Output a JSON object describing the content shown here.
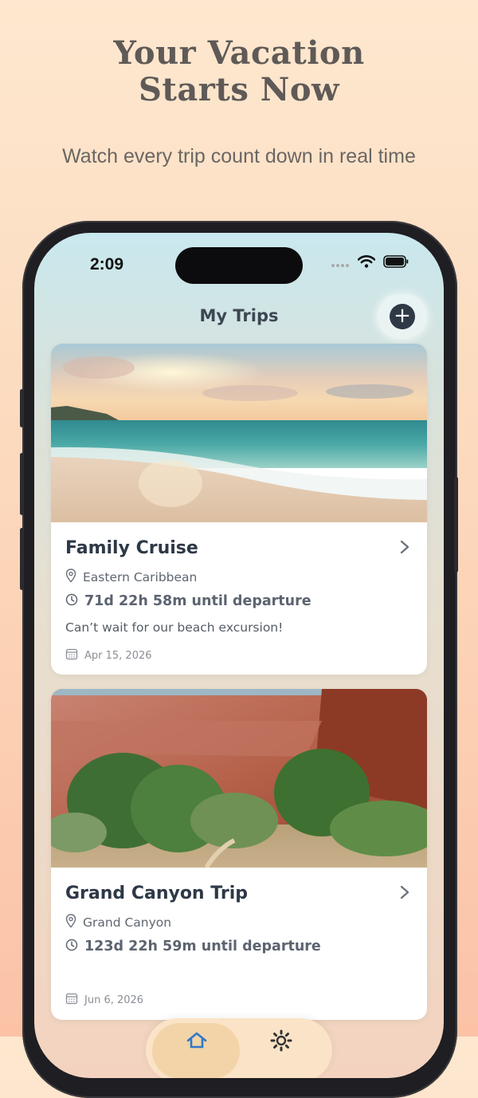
{
  "promo": {
    "headline_line1": "Your Vacation",
    "headline_line2": "Starts Now",
    "subtitle": "Watch every trip count down in real time"
  },
  "status_bar": {
    "time": "2:09"
  },
  "header": {
    "title": "My Trips"
  },
  "trips": [
    {
      "title": "Family Cruise",
      "location": "Eastern Caribbean",
      "countdown": "71d 22h 58m until departure",
      "note": "Can’t wait for our beach excursion!",
      "date": "Apr 15, 2026"
    },
    {
      "title": "Grand Canyon Trip",
      "location": "Grand Canyon",
      "countdown": "123d 22h 59m until departure",
      "note": "",
      "date": "Jun 6, 2026"
    }
  ],
  "tabbar": {
    "items": [
      "home-icon",
      "gear-icon"
    ],
    "selected": "home-icon"
  },
  "colors": {
    "accent": "#2f3946",
    "title_text": "#2e3947",
    "tab_active": "#2f78c8"
  }
}
